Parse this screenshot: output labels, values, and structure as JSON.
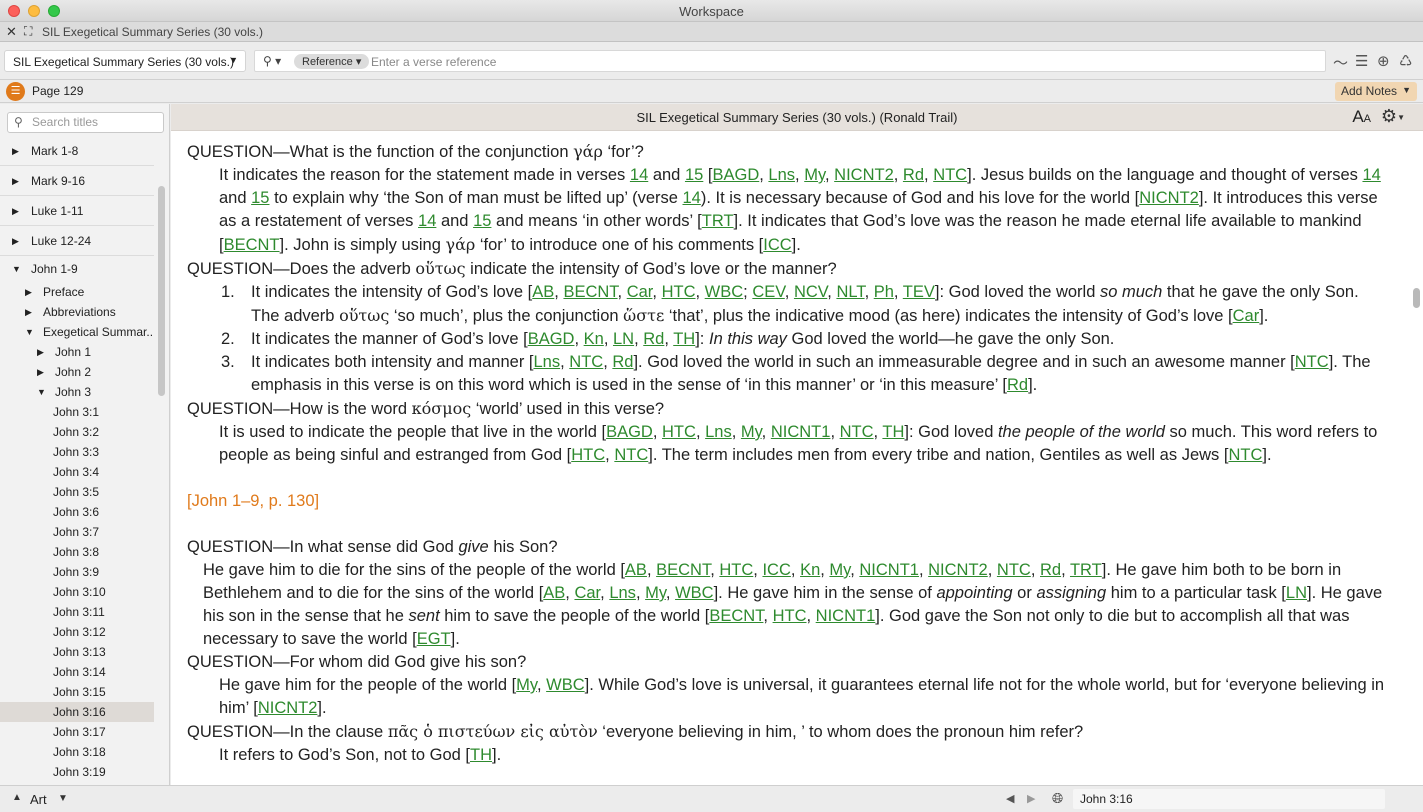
{
  "window": {
    "title": "Workspace"
  },
  "tab": {
    "title": "SIL Exegetical Summary Series (30 vols.)"
  },
  "toolbar": {
    "resource_selector": "SIL Exegetical Summary Series (30 vols.)",
    "reference_pill": "Reference",
    "search_placeholder": "Enter a verse reference",
    "icons": [
      "search-icon",
      "timeline-icon",
      "list-icon",
      "add-circle-icon",
      "recycle-icon"
    ]
  },
  "pagebar": {
    "page_label": "Page 129",
    "add_notes_label": "Add Notes"
  },
  "sidebar": {
    "search_placeholder": "Search titles",
    "items": [
      {
        "label": "Mark 1-8",
        "level": 0,
        "state": "collapsed"
      },
      {
        "label": "Mark 9-16",
        "level": 0,
        "state": "collapsed"
      },
      {
        "label": "Luke 1-11",
        "level": 0,
        "state": "collapsed"
      },
      {
        "label": "Luke 12-24",
        "level": 0,
        "state": "collapsed"
      },
      {
        "label": "John 1-9",
        "level": 0,
        "state": "expanded"
      },
      {
        "label": "Preface",
        "level": 1,
        "state": "collapsed"
      },
      {
        "label": "Abbreviations",
        "level": 1,
        "state": "collapsed"
      },
      {
        "label": "Exegetical Summar...",
        "level": 1,
        "state": "expanded"
      },
      {
        "label": "John 1",
        "level": 2,
        "state": "collapsed"
      },
      {
        "label": "John 2",
        "level": 2,
        "state": "collapsed"
      },
      {
        "label": "John 3",
        "level": 2,
        "state": "expanded"
      },
      {
        "label": "John 3:1",
        "level": 3
      },
      {
        "label": "John 3:2",
        "level": 3
      },
      {
        "label": "John 3:3",
        "level": 3
      },
      {
        "label": "John 3:4",
        "level": 3
      },
      {
        "label": "John 3:5",
        "level": 3
      },
      {
        "label": "John 3:6",
        "level": 3
      },
      {
        "label": "John 3:7",
        "level": 3
      },
      {
        "label": "John 3:8",
        "level": 3
      },
      {
        "label": "John 3:9",
        "level": 3
      },
      {
        "label": "John 3:10",
        "level": 3
      },
      {
        "label": "John 3:11",
        "level": 3
      },
      {
        "label": "John 3:12",
        "level": 3
      },
      {
        "label": "John 3:13",
        "level": 3
      },
      {
        "label": "John 3:14",
        "level": 3
      },
      {
        "label": "John 3:15",
        "level": 3
      },
      {
        "label": "John 3:16",
        "level": 3,
        "selected": true
      },
      {
        "label": "John 3:17",
        "level": 3
      },
      {
        "label": "John 3:18",
        "level": 3
      },
      {
        "label": "John 3:19",
        "level": 3
      }
    ]
  },
  "content": {
    "header_title": "SIL Exegetical Summary Series (30 vols.) (Ronald Trail)",
    "text_size_label": "AA",
    "q1": {
      "question_prefix": "QUESTION—What is the function of the conjunction ",
      "greek": "γάρ",
      "question_suffix": " ‘for’?"
    },
    "q2": {
      "question_prefix": "QUESTION—Does the adverb ",
      "greek": "οὕτως",
      "question_suffix": " indicate the intensity of God’s love or the manner?"
    },
    "q3": {
      "question_prefix": "QUESTION—How is the word ",
      "greek": "κόσμος",
      "question_suffix": " ‘world’ used in this verse?"
    },
    "page_ref": "[John 1–9, p. 130]",
    "q4": {
      "question_prefix": "QUESTION—In what sense did God ",
      "question_em": "give",
      "question_suffix": " his Son?"
    },
    "q5": {
      "question": "QUESTION—For whom did God give his son?"
    },
    "q6": {
      "question_prefix": "QUESTION—In the clause ",
      "greek": "πᾶς ὁ πιστεύων εἰς αὐτὸν",
      "question_suffix": " ‘everyone believing in him, ’ to whom does the pronoun him refer?"
    }
  },
  "bottombar": {
    "layout_label": "Art",
    "location_label": "John 3:16"
  }
}
